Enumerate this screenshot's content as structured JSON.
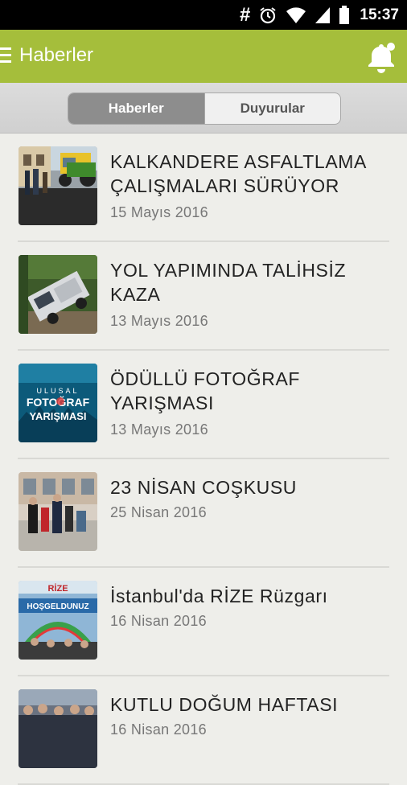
{
  "status_bar": {
    "time": "15:37",
    "hash_symbol": "#"
  },
  "app_bar": {
    "title": "Haberler",
    "menu_icon": "hamburger-menu-icon",
    "notification_icon": "bell-icon"
  },
  "tabs": [
    {
      "label": "Haberler",
      "active": true
    },
    {
      "label": "Duyurular",
      "active": false
    }
  ],
  "news": [
    {
      "title": "KALKANDERE ASFALTLAMA ÇALIŞMALARI SÜRÜYOR",
      "date": "15 Mayıs 2016"
    },
    {
      "title": "YOL YAPIMINDA TALİHSİZ KAZA",
      "date": "13 Mayıs 2016"
    },
    {
      "title": "ÖDÜLLÜ FOTOĞRAF YARIŞMASI",
      "date": "13 Mayıs 2016",
      "thumb_text": {
        "line1": "ULUSAL",
        "line2": "FOTOĞRAF",
        "line3": "YARIŞMASI"
      }
    },
    {
      "title": "23 NİSAN COŞKUSU",
      "date": "25 Nisan 2016"
    },
    {
      "title": "İstanbul'da RİZE Rüzgarı",
      "date": "16 Nisan 2016",
      "thumb_text": {
        "line1": "RİZE",
        "line2": "HOŞGELDUNUZ"
      }
    },
    {
      "title": "KUTLU DOĞUM HAFTASI",
      "date": "16 Nisan 2016"
    }
  ],
  "colors": {
    "accent": "#a5be3b",
    "status_bar": "#000000",
    "background": "#eeeeea"
  }
}
